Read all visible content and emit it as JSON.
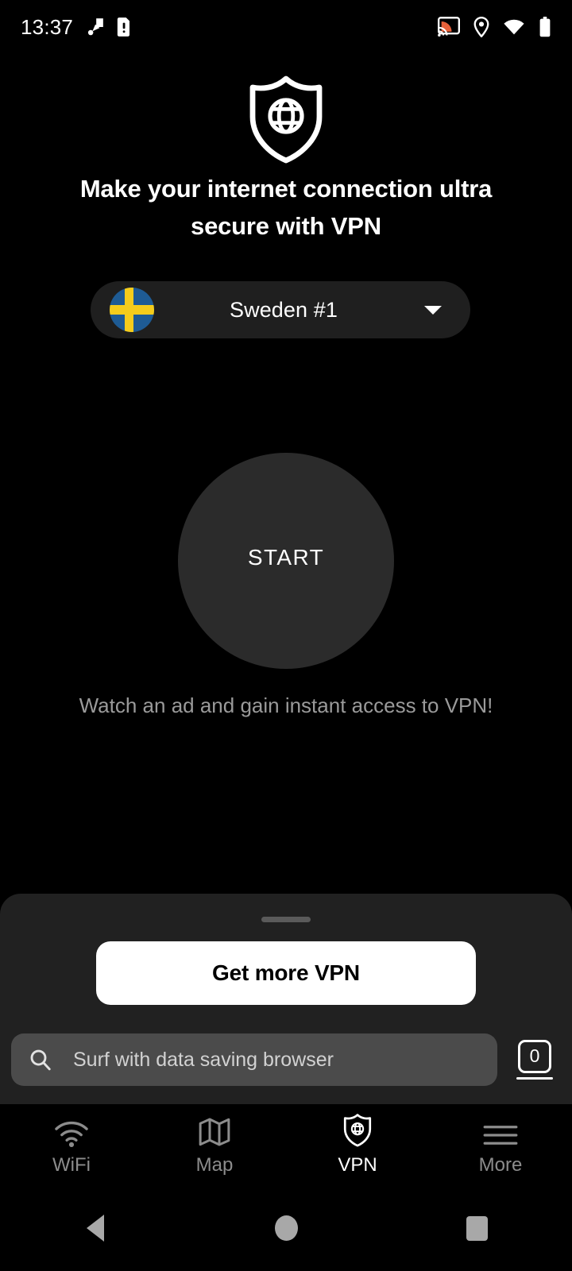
{
  "status_bar": {
    "time": "13:37",
    "left_icons": [
      {
        "name": "screenshot-capture-icon"
      },
      {
        "name": "sim-card-alert-icon"
      }
    ],
    "right_icons": [
      {
        "name": "cast-icon",
        "color": "#e8613a"
      },
      {
        "name": "location-pin-icon"
      },
      {
        "name": "wifi-icon"
      },
      {
        "name": "battery-icon"
      }
    ]
  },
  "hero": {
    "shield_icon": "shield-globe-icon",
    "headline": "Make your internet connection ultra secure with VPN"
  },
  "server_selector": {
    "flag_icon": "sweden-flag-icon",
    "name": "Sweden #1",
    "chevron_icon": "chevron-down-icon"
  },
  "connect": {
    "button_label": "START",
    "note": "Watch an ad and gain instant access to VPN!"
  },
  "sheet": {
    "handle": "drag-handle",
    "cta_label": "Get more VPN",
    "search": {
      "icon": "search-icon",
      "placeholder": "Surf with data saving browser",
      "value": ""
    },
    "tab_counter": {
      "icon": "tab-counter-icon",
      "count": "0"
    }
  },
  "bottom_nav": {
    "items": [
      {
        "label": "WiFi",
        "icon": "wifi-icon",
        "active": false
      },
      {
        "label": "Map",
        "icon": "map-icon",
        "active": false
      },
      {
        "label": "VPN",
        "icon": "shield-globe-icon",
        "active": true
      },
      {
        "label": "More",
        "icon": "hamburger-menu-icon",
        "active": false
      }
    ]
  },
  "system_nav": {
    "back": "back-button",
    "home": "home-button",
    "recents": "recents-button"
  },
  "colors": {
    "background": "#000000",
    "sheet": "#212121",
    "pill": "#1f1f1f",
    "start_circle": "#2b2b2b",
    "searchbar": "#4b4b4b",
    "cta_bg": "#ffffff",
    "muted_text": "#9a9a9a",
    "accent_cast": "#e8613a",
    "flag_blue": "#1e5b94",
    "flag_yellow": "#f5cc1b"
  }
}
